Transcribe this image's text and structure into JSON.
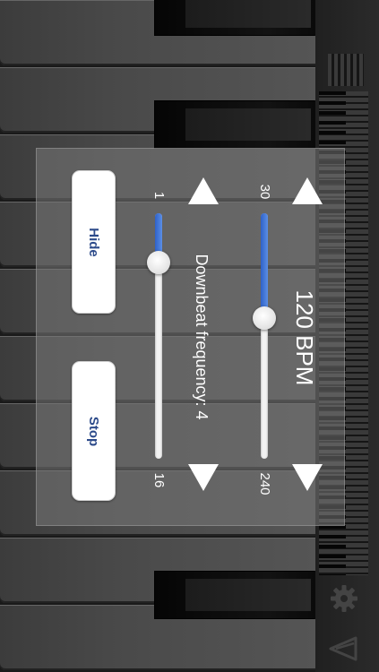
{
  "bpm": {
    "display": "120 BPM",
    "min_label": "30",
    "max_label": "240",
    "min": 30,
    "max": 240,
    "value": 120
  },
  "downbeat": {
    "display": "Downbeat frequency: 4",
    "min_label": "1",
    "max_label": "16",
    "min": 1,
    "max": 16,
    "value": 4
  },
  "buttons": {
    "hide": "Hide",
    "stop": "Stop"
  },
  "icons": {
    "settings": "gear-icon",
    "metronome": "metronome-icon"
  },
  "colors": {
    "slider_fill": "#3a6fd6",
    "button_text": "#2c4a8a"
  }
}
